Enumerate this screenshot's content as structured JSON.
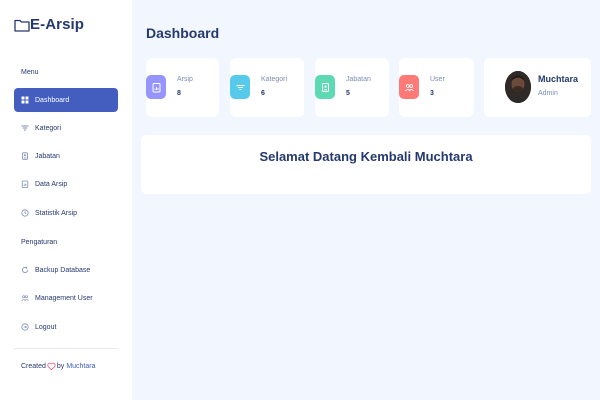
{
  "app": {
    "logo_text": "E-Arsip"
  },
  "sidebar": {
    "menu_title": "Menu",
    "settings_title": "Pengaturan",
    "menu_items": [
      {
        "label": "Dashboard",
        "icon": "grid-icon",
        "active": true
      },
      {
        "label": "Kategori",
        "icon": "filter-icon",
        "active": false
      },
      {
        "label": "Jabatan",
        "icon": "id-badge-icon",
        "active": false
      },
      {
        "label": "Data Arsip",
        "icon": "clipboard-data-icon",
        "active": false
      },
      {
        "label": "Statistik Arsip",
        "icon": "clock-icon",
        "active": false
      }
    ],
    "settings_items": [
      {
        "label": "Backup Database",
        "icon": "refresh-icon"
      },
      {
        "label": "Management User",
        "icon": "people-icon"
      },
      {
        "label": "Logout",
        "icon": "logout-icon"
      }
    ],
    "footer": {
      "created_text": "Created",
      "by_text": "by",
      "author": "Muchtara"
    }
  },
  "main": {
    "page_title": "Dashboard",
    "stats": [
      {
        "label": "Arsip",
        "value": "8",
        "icon": "clipboard-data-icon",
        "color": "#9694ff"
      },
      {
        "label": "Kategori",
        "value": "6",
        "icon": "filter-icon",
        "color": "#57caeb"
      },
      {
        "label": "Jabatan",
        "value": "5",
        "icon": "id-badge-icon",
        "color": "#5ddab4"
      },
      {
        "label": "User",
        "value": "3",
        "icon": "people-icon",
        "color": "#ff7976"
      }
    ],
    "user": {
      "name": "Muchtara",
      "role": "Admin"
    },
    "welcome_message": "Selamat Datang Kembali Muchtara"
  },
  "colors": {
    "primary": "#435ebe",
    "text": "#25396f",
    "muted": "#7c8db5",
    "background": "#f2f6fe"
  }
}
